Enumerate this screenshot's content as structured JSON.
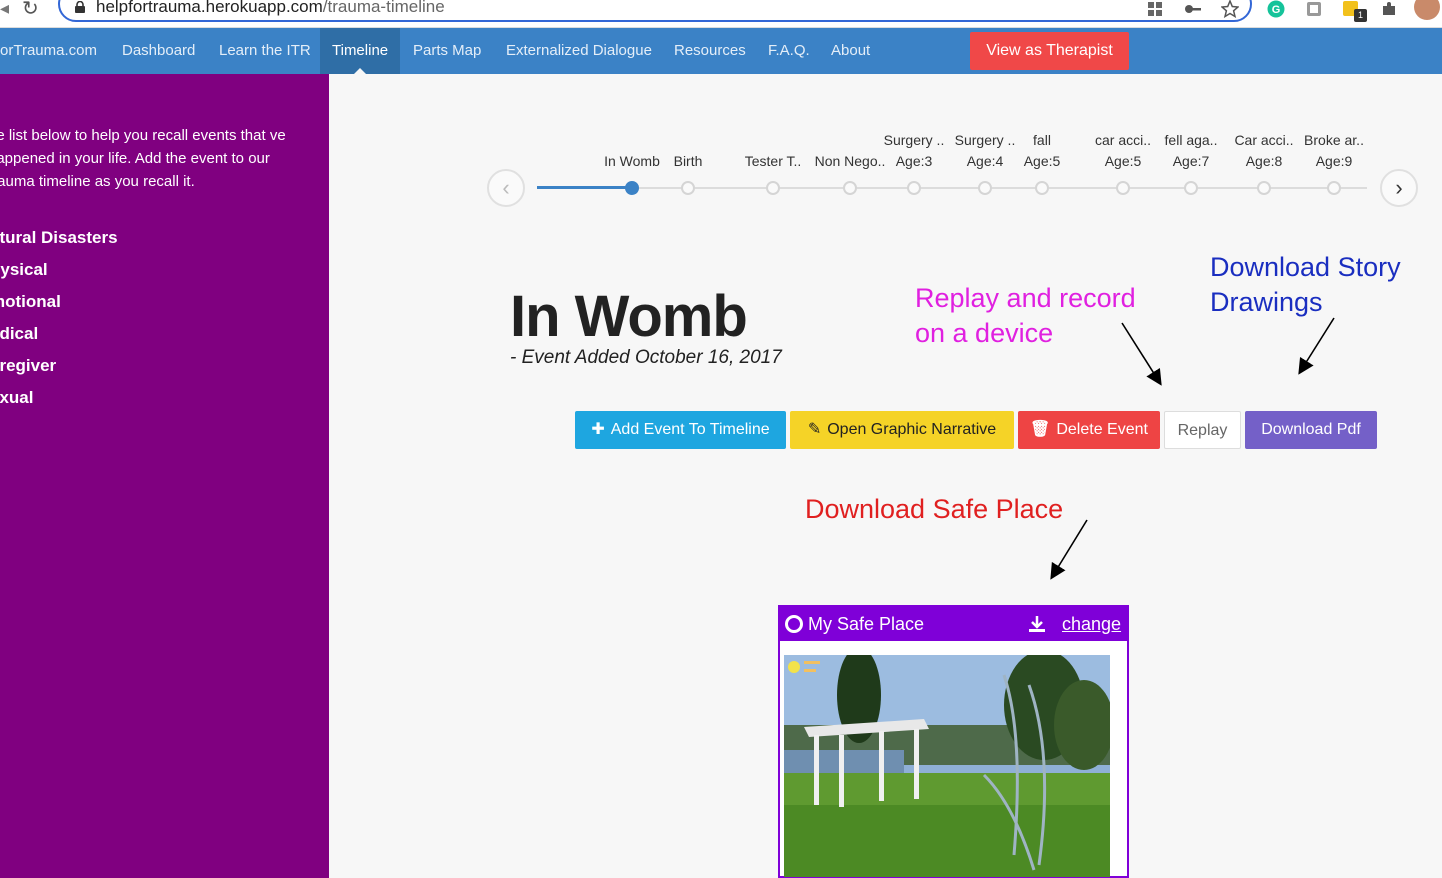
{
  "browser": {
    "url_host": "helpfortrauma.herokuapp.com",
    "url_path": "/trauma-timeline",
    "extension_badge": "1"
  },
  "nav": {
    "brand": "orTrauma.com",
    "items": [
      "Dashboard",
      "Learn the ITR",
      "Timeline",
      "Parts Map",
      "Externalized Dialogue",
      "Resources",
      "F.A.Q.",
      "About"
    ],
    "active": "Timeline",
    "therapist_button": "View as Therapist"
  },
  "sidebar": {
    "intro": "he list below to help you recall events that ve happened in your life. Add the event to our trauma timeline as you recall it.",
    "categories": [
      "atural Disasters",
      "hysical",
      "motional",
      "edical",
      "aregiver",
      "exual"
    ]
  },
  "timeline": {
    "events": [
      {
        "title": "In Womb",
        "age": ""
      },
      {
        "title": "Birth",
        "age": ""
      },
      {
        "title": "Tester T..",
        "age": ""
      },
      {
        "title": "Non Nego..",
        "age": ""
      },
      {
        "title": "Surgery ..",
        "age": "Age:3"
      },
      {
        "title": "Surgery ..",
        "age": "Age:4"
      },
      {
        "title": "fall",
        "age": "Age:5"
      },
      {
        "title": "car acci..",
        "age": "Age:5"
      },
      {
        "title": "fell aga..",
        "age": "Age:7"
      },
      {
        "title": "Car acci..",
        "age": "Age:8"
      },
      {
        "title": "Broke ar..",
        "age": "Age:9"
      }
    ],
    "active_index": 0
  },
  "event": {
    "title": "In Womb",
    "added": "- Event Added October 16, 2017"
  },
  "buttons": {
    "add": "Add Event To Timeline",
    "narrative": "Open Graphic Narrative",
    "delete": "Delete Event",
    "replay": "Replay",
    "pdf": "Download Pdf"
  },
  "annotations": {
    "replay_line1": "Replay and record",
    "replay_line2": "on a device",
    "story_line1": "Download Story",
    "story_line2": "Drawings",
    "safe_place": "Download Safe Place"
  },
  "safe_place": {
    "title": "My Safe Place",
    "change": "change"
  },
  "colors": {
    "nav": "#3b82c6",
    "sidebar": "#800080",
    "card": "#7f00d8"
  }
}
